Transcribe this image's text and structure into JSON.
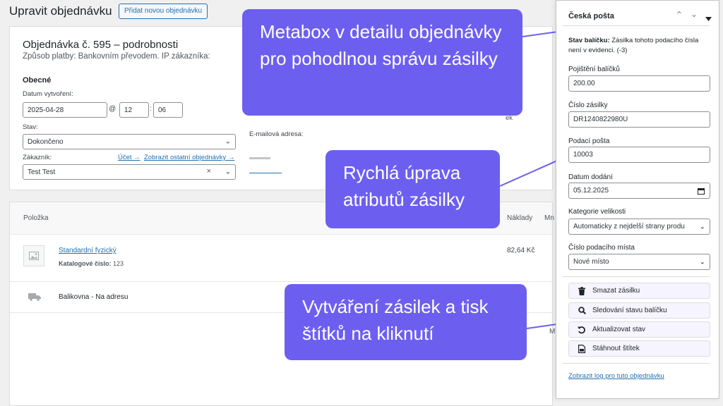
{
  "header": {
    "title": "Upravit objednávku",
    "add_button": "Přidat novou objednávku"
  },
  "order": {
    "heading": "Objednávka č. 595 – podrobnosti",
    "meta": "Způsob platby: Bankovním převodem. IP zákazníka:",
    "section_general": "Obecné",
    "date_label": "Datum vytvoření:",
    "date_value": "2025-04-28",
    "at_sign": "@",
    "hour_value": "12",
    "colon": ":",
    "minute_value": "06",
    "status_label": "Stav:",
    "status_value": "Dokončeno",
    "customer_label": "Zákazník:",
    "account_link": "Účet →",
    "other_orders_link": "Zobrazit ostatní objednávky →",
    "customer_value": "Test Test",
    "clear_symbol": "×",
    "email_label": "E-mailová adresa:",
    "partial_right": "ek"
  },
  "items": {
    "col_item": "Položka",
    "col_costs": "Náklady",
    "col_cut": "Mn",
    "product_name": "Standardní fyzický",
    "sku_label": "Katalogové číslo:",
    "sku_value": "123",
    "product_cost": "82,64 Kč",
    "shipping_name": "Balikovna - Na adresu",
    "partial_m": "M"
  },
  "callouts": {
    "metabox": "Metabox v detailu objednávky pro pohodlnou správu zásilky",
    "quick_edit": "Rychlá úprava atributů zásilky",
    "create": "Vytváření zásilek a tisk štítků na kliknutí"
  },
  "metabox": {
    "title": "Česká pošta",
    "status_label": "Stav balíčku:",
    "status_text": "Zásilka tohoto podacího čísla není v evidenci. (-3)",
    "insurance_label": "Pojištění balíčků",
    "insurance_value": "200.00",
    "tracking_label": "Číslo zásilky",
    "tracking_value": "DR1240822980U",
    "post_office_label": "Podací pošta",
    "post_office_value": "10003",
    "delivery_date_label": "Datum dodání",
    "delivery_date_value": "05.12.2025",
    "size_label": "Kategorie velikosti",
    "size_value": "Automaticky z nejdelší strany produ",
    "place_label": "Číslo podacího místa",
    "place_value": "Nové místo",
    "btn_delete": "Smazat zásilku",
    "btn_track": "Sledování stavu balíčku",
    "btn_refresh": "Aktualizovat stav",
    "btn_download": "Stáhnout štítek",
    "log_link": "Zobrazit log pro tuto objednávku"
  },
  "colors": {
    "callout": "#6c5ff0",
    "link": "#2271b1",
    "button_bg": "#f6f4ff"
  }
}
